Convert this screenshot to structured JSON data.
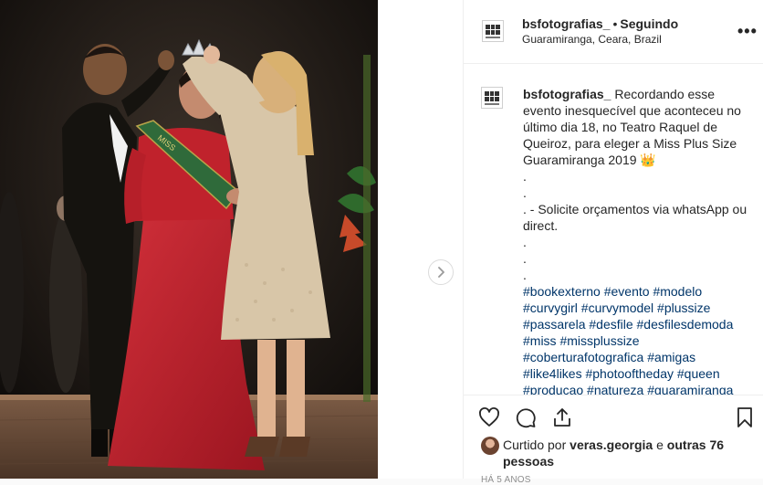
{
  "post": {
    "username": "bsfotografias_",
    "separator": "•",
    "follow_status": "Seguindo",
    "location": "Guaramiranga, Ceara, Brazil",
    "more_glyph": "•••"
  },
  "caption": {
    "username": "bsfotografias_",
    "text": " Recordando esse evento inesquecível que aconteceu no último dia 18, no Teatro Raquel de Queiroz, para eleger a Miss Plus Size Guaramiranga 2019 👑\n.\n.\n. - Solicite orçamentos via whatsApp ou direct.\n.\n.\n.\n",
    "hashtags": "#bookexterno #evento #modelo #curvygirl #curvymodel #plussize #passarela #desfile #desfilesdemoda #miss #missplussize #coberturafotografica #amigas #like4likes #photooftheday #queen #producao #natureza #guaramiranga"
  },
  "likes": {
    "prefix": "Curtido por ",
    "user": "veras.georgia",
    "middle": " e ",
    "others": "outras 76 pessoas"
  },
  "timestamp": "HÁ 5 ANOS",
  "icons": {
    "like": "heart-icon",
    "comment": "comment-icon",
    "share": "share-icon",
    "save": "bookmark-icon",
    "next": "chevron-right-icon",
    "more": "more-options-icon"
  },
  "colors": {
    "hashtag": "#003569",
    "dress_red": "#c0222c",
    "sash_green": "#2f6a3a",
    "dress_lace": "#d8c6a8"
  }
}
